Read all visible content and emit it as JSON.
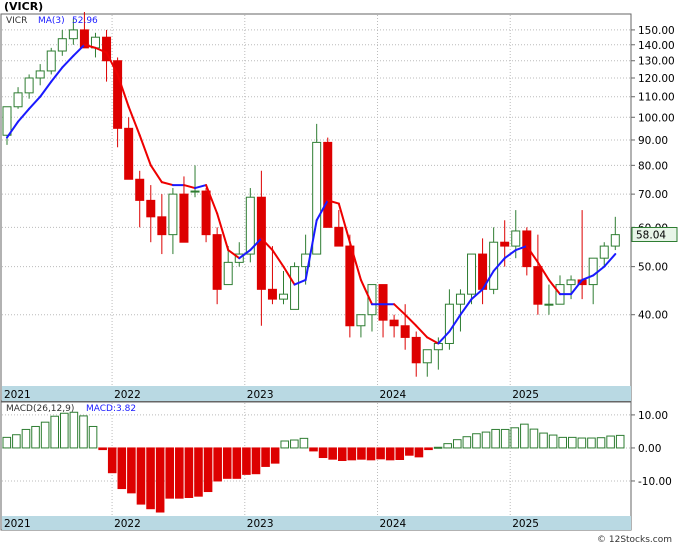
{
  "title": "(VICR)",
  "footer": "© 12Stocks.com",
  "colors": {
    "up": "#2e7d32",
    "down": "#dd0000",
    "ma": "#1a1aff",
    "ma_down": "#ee0000",
    "strip": "#b9d9e3",
    "grid": "#bbbbbb",
    "macd_up": "#2e7d32",
    "macd_down": "#dd0000"
  },
  "price_panel": {
    "legend_symbol": "VICR",
    "legend_ma": "MA(3)",
    "legend_ma_value": "52.96",
    "last_price": "58.04",
    "scale": "log",
    "y_ticks": [
      40,
      50,
      60,
      70,
      80,
      90,
      100,
      110,
      120,
      130,
      140,
      150
    ],
    "y_tick_labels": [
      "40.00",
      "50.00",
      "60.00",
      "70.00",
      "80.00",
      "90.00",
      "100.00",
      "110.00",
      "120.00",
      "130.00",
      "140.00",
      "150.00"
    ],
    "x_labels": [
      "2021",
      "2022",
      "2023",
      "2024",
      "2025"
    ]
  },
  "macd_panel": {
    "legend_label": "MACD(26,12,9)",
    "legend_value_label": "MACD:3.82",
    "y_ticks": [
      10,
      0,
      -10
    ],
    "y_tick_labels": [
      "10.00",
      "0.00",
      "-10.00"
    ],
    "x_labels": [
      "2021",
      "2022",
      "2023",
      "2024",
      "2025"
    ]
  },
  "chart_data": [
    {
      "type": "candlestick",
      "title": "(VICR)",
      "interval": "monthly",
      "year_starts": {
        "2021": 0,
        "2022": 10,
        "2023": 22,
        "2024": 34,
        "2025": 46
      },
      "ohlc": [
        [
          92,
          105,
          88,
          105
        ],
        [
          105,
          115,
          104,
          112
        ],
        [
          112,
          122,
          109,
          120
        ],
        [
          120,
          128,
          116,
          124
        ],
        [
          124,
          138,
          122,
          136
        ],
        [
          136,
          150,
          133,
          144
        ],
        [
          144,
          158,
          140,
          150
        ],
        [
          150,
          163,
          138,
          138
        ],
        [
          138,
          148,
          132,
          145
        ],
        [
          145,
          150,
          118,
          130
        ],
        [
          130,
          132,
          87,
          95
        ],
        [
          95,
          100,
          75,
          75
        ],
        [
          75,
          78,
          60,
          68
        ],
        [
          68,
          73,
          56,
          63
        ],
        [
          63,
          70,
          53,
          58
        ],
        [
          58,
          72,
          53,
          70
        ],
        [
          70,
          76,
          56,
          56
        ],
        [
          71,
          80,
          69,
          71
        ],
        [
          71,
          72,
          56,
          58
        ],
        [
          58,
          60,
          42,
          45
        ],
        [
          46,
          55,
          46,
          51
        ],
        [
          51,
          56,
          50,
          53
        ],
        [
          53,
          72,
          51,
          69
        ],
        [
          69,
          78,
          38,
          45
        ],
        [
          45,
          55,
          42,
          43
        ],
        [
          43,
          49,
          42,
          44
        ],
        [
          41,
          51,
          41,
          50
        ],
        [
          50,
          58,
          46,
          53
        ],
        [
          53,
          97,
          53,
          89
        ],
        [
          89,
          91,
          60,
          60
        ],
        [
          60,
          65,
          55,
          55
        ],
        [
          55,
          58,
          36,
          38
        ],
        [
          38,
          40,
          36,
          40
        ],
        [
          40,
          46,
          37,
          46
        ],
        [
          46,
          46,
          36,
          39
        ],
        [
          39,
          40,
          36,
          38
        ],
        [
          38,
          42,
          34,
          36
        ],
        [
          36,
          37,
          30,
          32
        ],
        [
          32,
          34,
          30,
          34
        ],
        [
          34,
          36,
          31,
          35
        ],
        [
          35,
          45,
          34,
          42
        ],
        [
          42,
          45,
          37,
          44
        ],
        [
          44,
          52,
          42,
          53
        ],
        [
          53,
          57,
          42,
          45
        ],
        [
          45,
          60,
          44,
          56
        ],
        [
          56,
          62,
          50,
          55
        ],
        [
          55,
          65,
          52,
          59
        ],
        [
          59,
          60,
          48,
          50
        ],
        [
          50,
          58,
          40,
          42
        ],
        [
          42,
          46,
          40,
          42
        ],
        [
          42,
          48,
          42,
          46
        ],
        [
          46,
          48,
          43,
          47
        ],
        [
          47,
          65,
          43,
          46
        ],
        [
          46,
          50,
          42,
          52
        ],
        [
          52,
          56,
          50,
          55
        ],
        [
          55,
          63,
          54,
          58
        ]
      ],
      "ma3": [
        91,
        98,
        104,
        110,
        118,
        126,
        133,
        140,
        138,
        135,
        122,
        105,
        92,
        80,
        74,
        73,
        73,
        72,
        73,
        64,
        54,
        52,
        54,
        57,
        54,
        50,
        46,
        47,
        62,
        68,
        67,
        56,
        47,
        42,
        42,
        42,
        40,
        38,
        36,
        35,
        37,
        40,
        43,
        45,
        49,
        52,
        54,
        55,
        51,
        47,
        44,
        44,
        47,
        48,
        50,
        53
      ],
      "ylim": [
        29,
        160
      ]
    },
    {
      "type": "bar",
      "title": "MACD(26,12,9)",
      "values": [
        3.2,
        4.0,
        5.6,
        6.5,
        7.8,
        9.6,
        10.5,
        10.8,
        9.7,
        6.5,
        -0.5,
        -7.5,
        -12.3,
        -13.6,
        -17.0,
        -18.4,
        -19.4,
        -15.2,
        -15.2,
        -15.0,
        -14.6,
        -13.2,
        -10.0,
        -9.2,
        -9.2,
        -8.0,
        -7.8,
        -5.6,
        -4.6,
        2.1,
        2.4,
        2.9,
        -0.9,
        -2.9,
        -3.4,
        -3.8,
        -3.6,
        -3.4,
        -3.6,
        -3.3,
        -3.6,
        -3.5,
        -2.2,
        -2.7,
        -0.5,
        0.2,
        1.3,
        2.5,
        3.4,
        4.3,
        4.8,
        5.6,
        5.6,
        6.1,
        7.2,
        5.7,
        4.5,
        3.9,
        3.2,
        3.2,
        3.0,
        3.0,
        3.1,
        3.6,
        3.8
      ],
      "ylim": [
        -20,
        13
      ]
    }
  ]
}
